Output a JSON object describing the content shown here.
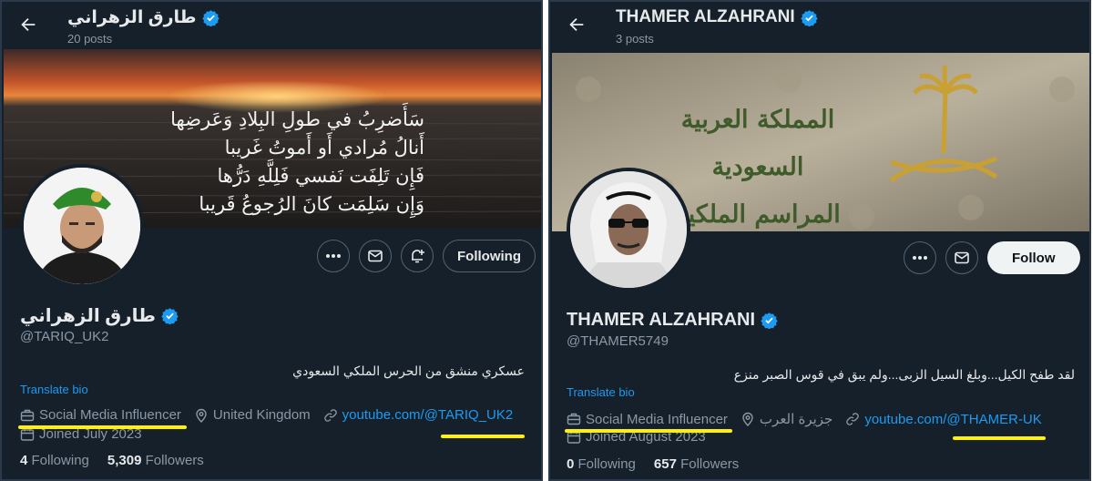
{
  "left": {
    "header": {
      "name": "طارق الزهراني",
      "posts": "20 posts"
    },
    "banner": {
      "poem": [
        "سَأَضرِبُ في طولِ البِلادِ وَعَرضِها",
        "أَنالُ مُرادي أَو أَموتُ غَريبا",
        "فَإِن تَلِفَت نَفسي فَلِلَّهِ دَرُّها",
        "وَإِن سَلِمَت كانَ الرُجوعُ قَريبا"
      ]
    },
    "actions": {
      "more_icon": "more-icon",
      "message_icon": "mail-icon",
      "notify_icon": "bell-plus-icon",
      "following": "Following"
    },
    "profile": {
      "display_name": "طارق الزهراني",
      "handle": "@TARIQ_UK2",
      "bio": "عسكري منشق من الحرس الملكي السعودي",
      "translate": "Translate bio",
      "category": "Social Media Influencer",
      "location": "United Kingdom",
      "link": "youtube.com/@TARIQ_UK2",
      "joined": "Joined July 2023",
      "following_count": "4",
      "following_label": "Following",
      "followers_count": "5,309",
      "followers_label": "Followers"
    }
  },
  "right": {
    "header": {
      "name": "THAMER ALZAHRANI",
      "posts": "3 posts"
    },
    "banner": {
      "text_line1": "المملكة العربية السعودية",
      "text_line2": "المراسم الملكية"
    },
    "actions": {
      "more_icon": "more-icon",
      "message_icon": "mail-icon",
      "follow": "Follow"
    },
    "profile": {
      "display_name": "THAMER ALZAHRANI",
      "handle": "@THAMER5749",
      "bio": "لقد طفح الكيل...وبلغ السيل الزبى...ولم يبق في قوس الصبر منزع",
      "translate": "Translate bio",
      "category": "Social Media Influencer",
      "location": "جزيرة العرب",
      "link": "youtube.com/@THAMER-UK",
      "joined": "Joined August 2023",
      "following_count": "0",
      "following_label": "Following",
      "followers_count": "657",
      "followers_label": "Followers"
    }
  },
  "colors": {
    "background": "#15202b",
    "accent": "#1d9bf0",
    "highlight": "#fff200",
    "muted": "#8b98a5"
  }
}
